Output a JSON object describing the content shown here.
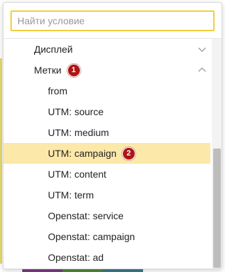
{
  "search": {
    "placeholder": "Найти условие",
    "value": ""
  },
  "groups": [
    {
      "label": "Дисплей",
      "expanded": false,
      "chevron_icon": "chevron-down-icon"
    },
    {
      "label": "Метки",
      "expanded": true,
      "chevron_icon": "chevron-up-icon",
      "badge": "1"
    }
  ],
  "items": [
    {
      "label": "from",
      "selected": false
    },
    {
      "label": "UTM: source",
      "selected": false
    },
    {
      "label": "UTM: medium",
      "selected": false
    },
    {
      "label": "UTM: campaign",
      "selected": true,
      "badge": "2"
    },
    {
      "label": "UTM: content",
      "selected": false
    },
    {
      "label": "UTM: term",
      "selected": false
    },
    {
      "label": "Openstat: service",
      "selected": false
    },
    {
      "label": "Openstat: campaign",
      "selected": false
    },
    {
      "label": "Openstat: ad",
      "selected": false
    }
  ],
  "colors": {
    "search_border": "#f2cd3d",
    "selected_bg": "#fce8a8",
    "badge_bg": "#b01414",
    "scroll_thumb": "#bdbdbd"
  },
  "background_strip_colors": [
    "#ffffff",
    "#7e3a86",
    "#4d8a3a",
    "#3a7a8a",
    "#ffffff"
  ]
}
